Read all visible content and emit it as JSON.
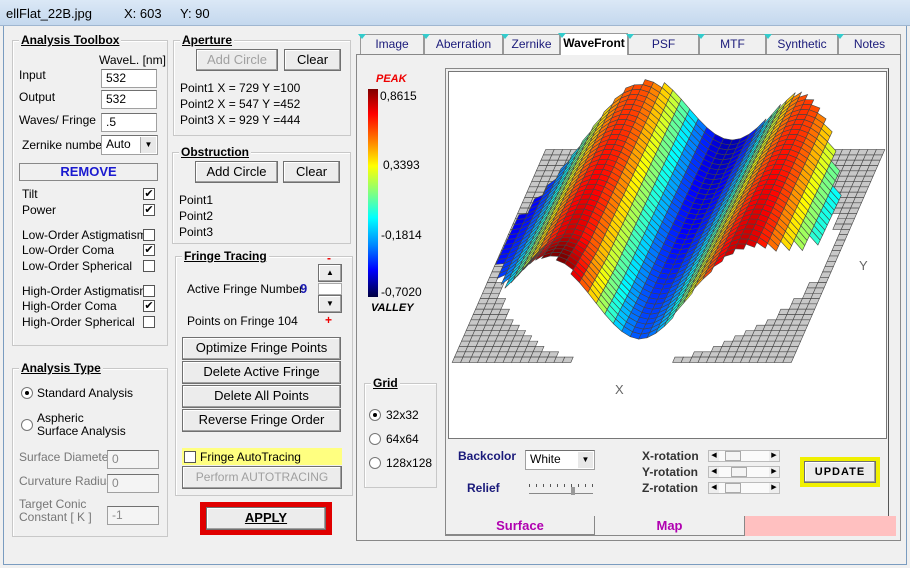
{
  "titlebar": {
    "filename": "ellFlat_22B.jpg",
    "x": "X: 603",
    "y": "Y: 90"
  },
  "toolbox": {
    "title": "Analysis Toolbox",
    "wavel_header": "WaveL. [nm]",
    "input_label": "Input",
    "input_value": "532",
    "output_label": "Output",
    "output_value": "532",
    "wpf_label": "Waves/ Fringe",
    "wpf_value": ".5",
    "zernike_label": "Zernike number",
    "zernike_value": "Auto",
    "remove_label": "REMOVE",
    "terms": [
      {
        "label": "Tilt",
        "checked": true
      },
      {
        "label": "Power",
        "checked": true
      },
      {
        "label": "Low-Order  Astigmatism",
        "checked": false
      },
      {
        "label": "Low-Order  Coma",
        "checked": true
      },
      {
        "label": "Low-Order  Spherical",
        "checked": false
      },
      {
        "label": "High-Order  Astigmatism",
        "checked": false
      },
      {
        "label": "High-Order  Coma",
        "checked": true
      },
      {
        "label": "High-Order  Spherical",
        "checked": false
      }
    ]
  },
  "analysis_type": {
    "title": "Analysis Type",
    "standard": "Standard  Analysis",
    "aspheric": "Aspheric  Surface Analysis",
    "selected": "standard",
    "surface_diameter_label": "Surface Diameter",
    "surface_diameter": "0",
    "curvature_radius_label": "Curvature Radius",
    "curvature_radius": "0",
    "conic_label": "Target Conic Constant [ K ]",
    "conic": "-1"
  },
  "aperture": {
    "title": "Aperture",
    "add_circle": "Add Circle",
    "clear": "Clear",
    "points": [
      "Point1  X =   729   Y =100",
      "Point2  X =   547   Y =452",
      "Point3  X =   929   Y =444"
    ]
  },
  "obstruction": {
    "title": "Obstruction",
    "add_circle": "Add Circle",
    "clear": "Clear",
    "points": [
      "Point1",
      "Point2",
      "Point3"
    ]
  },
  "fringe": {
    "title": "Fringe Tracing",
    "active_label": "Active Fringe Number",
    "active_value": "9",
    "points_label": "Points on  Fringe 104",
    "minus": "-",
    "plus": "+",
    "optimize": "Optimize Fringe Points",
    "delete_active": "Delete Active Fringe",
    "delete_all": "Delete  All  Points",
    "reverse": "Reverse  Fringe Order",
    "autotracing_label": "Fringe AutoTracing",
    "autotracing_checked": false,
    "perform": "Perform  AUTOTRACING"
  },
  "apply_label": "APPLY",
  "tabs": [
    {
      "label": "Image"
    },
    {
      "label": "Aberration"
    },
    {
      "label": "Zernike"
    },
    {
      "label": "WaveFront",
      "active": true
    },
    {
      "label": "PSF"
    },
    {
      "label": "MTF"
    },
    {
      "label": "Synthetic"
    },
    {
      "label": "Notes"
    }
  ],
  "colorbar": {
    "peak": "PEAK",
    "valley": "VALLEY",
    "ticks": [
      "0,8615",
      "0,3393",
      "-0,1814",
      "-0,7020"
    ]
  },
  "plot": {
    "x_axis": "X",
    "y_axis": "Y"
  },
  "grid": {
    "title": "Grid",
    "options": [
      "32x32",
      "64x64",
      "128x128"
    ],
    "selected": "32x32"
  },
  "controls": {
    "backcolor_label": "Backcolor",
    "backcolor_value": "White",
    "relief_label": "Relief",
    "relief_level": 0.7,
    "x_rotation": "X-rotation",
    "y_rotation": "Y-rotation",
    "z_rotation": "Z-rotation",
    "update": "UPDATE"
  },
  "subtabs": [
    {
      "label": "Surface",
      "active": true
    },
    {
      "label": "Map"
    }
  ],
  "colors": {
    "accent_blue": "#1a1aa0",
    "magenta": "#b000b0",
    "apply_border": "#e00000",
    "update_border": "#f0f000",
    "autotracing_bg": "#ffff80",
    "subtab_pink": "#ffc0c0"
  }
}
